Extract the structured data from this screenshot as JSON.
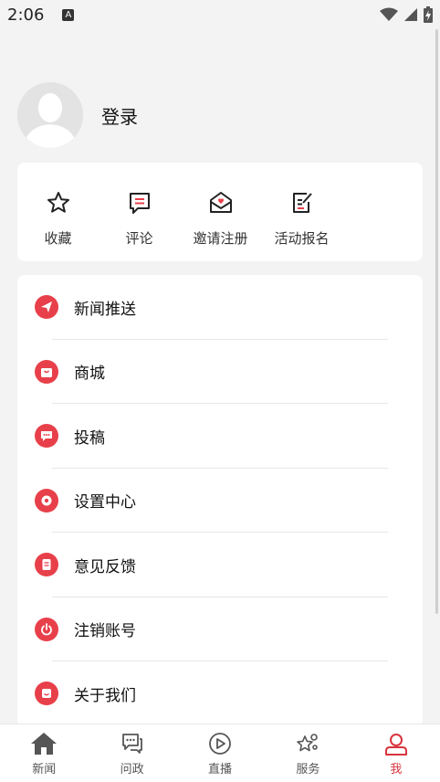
{
  "status_bar": {
    "time": "2:06",
    "notification_icon": "a-icon",
    "icons": [
      "wifi-icon",
      "signal-icon",
      "battery-icon"
    ]
  },
  "profile": {
    "login_label": "登录",
    "avatar": "default-avatar"
  },
  "quick_actions": [
    {
      "label": "收藏",
      "icon": "star-icon"
    },
    {
      "label": "评论",
      "icon": "comment-icon"
    },
    {
      "label": "邀请注册",
      "icon": "invite-envelope-icon"
    },
    {
      "label": "活动报名",
      "icon": "signup-edit-icon"
    }
  ],
  "menu": [
    {
      "label": "新闻推送",
      "icon": "paper-plane-icon"
    },
    {
      "label": "商城",
      "icon": "shop-icon"
    },
    {
      "label": "投稿",
      "icon": "chat-bubble-icon"
    },
    {
      "label": "设置中心",
      "icon": "settings-gear-icon"
    },
    {
      "label": "意见反馈",
      "icon": "feedback-doc-icon"
    },
    {
      "label": "注销账号",
      "icon": "power-icon"
    },
    {
      "label": "关于我们",
      "icon": "smile-icon"
    }
  ],
  "tabbar": {
    "active_color": "#d8343d",
    "tabs": [
      {
        "label": "新闻",
        "icon": "home-icon"
      },
      {
        "label": "问政",
        "icon": "consult-chat-icon"
      },
      {
        "label": "直播",
        "icon": "play-circle-icon"
      },
      {
        "label": "服务",
        "icon": "service-star-icon"
      },
      {
        "label": "我",
        "icon": "user-icon",
        "active": true
      }
    ]
  },
  "colors": {
    "accent": "#e8404a",
    "background": "#f3f3f3",
    "card": "#ffffff"
  }
}
